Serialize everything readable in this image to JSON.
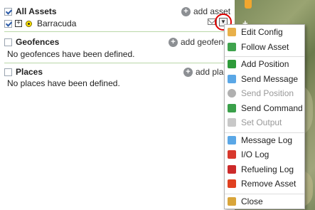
{
  "assets": {
    "title": "All Assets",
    "add_label": "add asset",
    "items": [
      {
        "name": "Barracuda"
      }
    ]
  },
  "geofences": {
    "title": "Geofences",
    "add_label": "add geofence",
    "empty_text": "No geofences have been defined."
  },
  "places": {
    "title": "Places",
    "add_label": "add place",
    "empty_text": "No places have been defined."
  },
  "context_menu": {
    "items": [
      {
        "label": "Edit Config",
        "icon": "edit-config-icon",
        "color": "#e8b04a",
        "disabled": false
      },
      {
        "label": "Follow Asset",
        "icon": "follow-asset-icon",
        "color": "#3fa34d",
        "disabled": false
      },
      {
        "label": "Add Position",
        "icon": "add-position-icon",
        "color": "#2e9b3a",
        "disabled": false
      },
      {
        "label": "Send Message",
        "icon": "send-message-icon",
        "color": "#5aa7e6",
        "disabled": false
      },
      {
        "label": "Send Position",
        "icon": "send-position-icon",
        "color": "#b0b0b0",
        "disabled": true
      },
      {
        "label": "Send Command",
        "icon": "send-command-icon",
        "color": "#3aa04a",
        "disabled": false
      },
      {
        "label": "Set Output",
        "icon": "set-output-icon",
        "color": "#c8c8c8",
        "disabled": true
      },
      {
        "label": "Message Log",
        "icon": "message-log-icon",
        "color": "#5aa7e6",
        "disabled": false
      },
      {
        "label": "I/O Log",
        "icon": "io-log-icon",
        "color": "#d8382c",
        "disabled": false
      },
      {
        "label": "Refueling Log",
        "icon": "refueling-log-icon",
        "color": "#cc2a2a",
        "disabled": false
      },
      {
        "label": "Remove Asset",
        "icon": "remove-asset-icon",
        "color": "#e04020",
        "disabled": false
      },
      {
        "label": "Close",
        "icon": "close-icon",
        "color": "#d9a53a",
        "disabled": false
      }
    ]
  }
}
